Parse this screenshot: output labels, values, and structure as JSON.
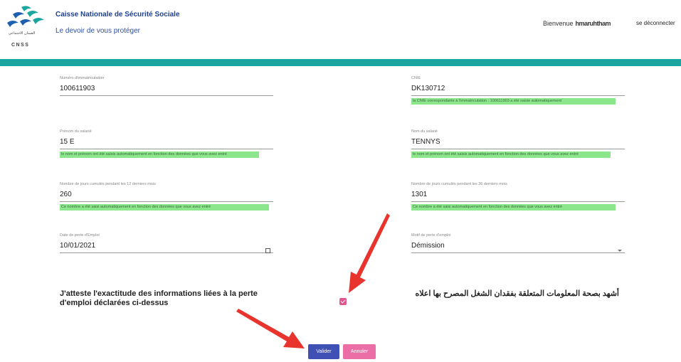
{
  "header": {
    "org_name": "Caisse Nationale de Sécurité Sociale",
    "tagline": "Le devoir de vous protéger",
    "welcome_prefix": "Bienvenue",
    "user_name": "hmaruhtham",
    "logout": "se déconnecter",
    "logo_ar": "الضمان الاجتماعي",
    "logo_latin": "CNSS"
  },
  "form": {
    "immatriculation": {
      "label": "Numéro d'immatriculation",
      "value": "100611903"
    },
    "cnie": {
      "label": "CNIE",
      "value": "DK130712",
      "note": "la CNIE correspondante à l'immatriculation : 100611903 a été saisie automatiquement"
    },
    "prenom": {
      "label": "Prénom du salarié",
      "value": "15 E",
      "note": "le nom et prénom ont été saisis automatiquement en fonction des données que vous avez entré"
    },
    "nom": {
      "label": "Nom du salarié",
      "value": "TENNYS",
      "note": "le nom et prénom ont été saisis automatiquement en fonction des données que vous avez entré"
    },
    "jours_12": {
      "label": "Nombre de jours cumulés pendant les 12 derniers mois",
      "value": "260",
      "note": "Ce nombre a été saisi automatiquement en fonction des données que vous avez entré"
    },
    "jours_36": {
      "label": "Nombre de jours cumulés pendant les 36 derniers mois",
      "value": "1301",
      "note": "Ce nombre a été saisi automatiquement en fonction des données que vous avez entré"
    },
    "date_perte": {
      "label": "Date de perte d'Emploi",
      "value": "10/01/2021"
    },
    "motif": {
      "label": "Motif de perte d'emploi",
      "value": "Démission"
    }
  },
  "attestation": {
    "fr": "J'atteste l'exactitude des informations liées à la perte d'emploi déclarées ci-dessus",
    "ar": "أشهد بصحة المعلومات المتعلقة بفقدان الشغل المصرح بها اعلاه",
    "checked": true
  },
  "buttons": {
    "valider": "Valider",
    "annuler": "Annuler"
  },
  "colors": {
    "teal_bar": "#1aa6a0",
    "note_green": "#8ce78c",
    "primary": "#3f51b5",
    "accent_pink": "#ec6ea6",
    "arrow_red": "#e8342c"
  }
}
